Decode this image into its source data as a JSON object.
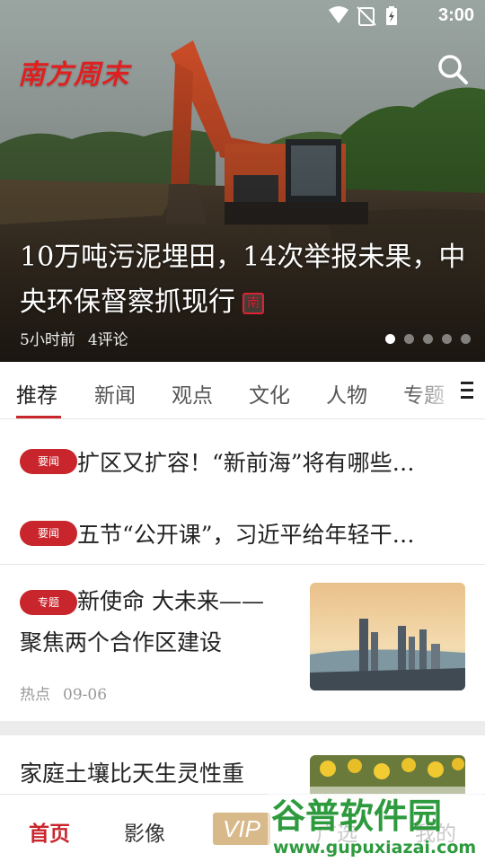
{
  "status_bar": {
    "time": "3:00"
  },
  "header": {
    "logo_text": "南方周末"
  },
  "hero": {
    "title_line1": "10万吨污泥埋田，14次举报未果，中",
    "title_line2": "央环保督察抓现行",
    "seal_char": "南",
    "time_ago": "5小时前",
    "comments": "4评论",
    "dots_count": 5,
    "active_dot": 0
  },
  "tabs": [
    "推荐",
    "新闻",
    "观点",
    "文化",
    "人物",
    "专题"
  ],
  "headlines": [
    {
      "badge": "要闻",
      "text": "扩区又扩容！“新前海”将有哪些…"
    },
    {
      "badge": "要闻",
      "text": "五节“公开课”，习近平给年轻干…"
    }
  ],
  "articles": [
    {
      "badge": "专题",
      "title_line1": "新使命 大未来——",
      "title_line2": "聚焦两个合作区建设",
      "tag": "热点",
      "date": "09-06"
    },
    {
      "title_line1": "家庭土壤比天生灵性重"
    }
  ],
  "bottom_nav": {
    "home": "首页",
    "video": "影像",
    "vip": "VIP",
    "gallery": "广选",
    "me": "我的"
  },
  "watermark": {
    "brand": "谷普软件园",
    "url": "www.gupuxiazai.com"
  },
  "colors": {
    "accent": "#c9252c",
    "vip_gold": "#d8b98a",
    "watermark_green": "#2e9a3e"
  }
}
